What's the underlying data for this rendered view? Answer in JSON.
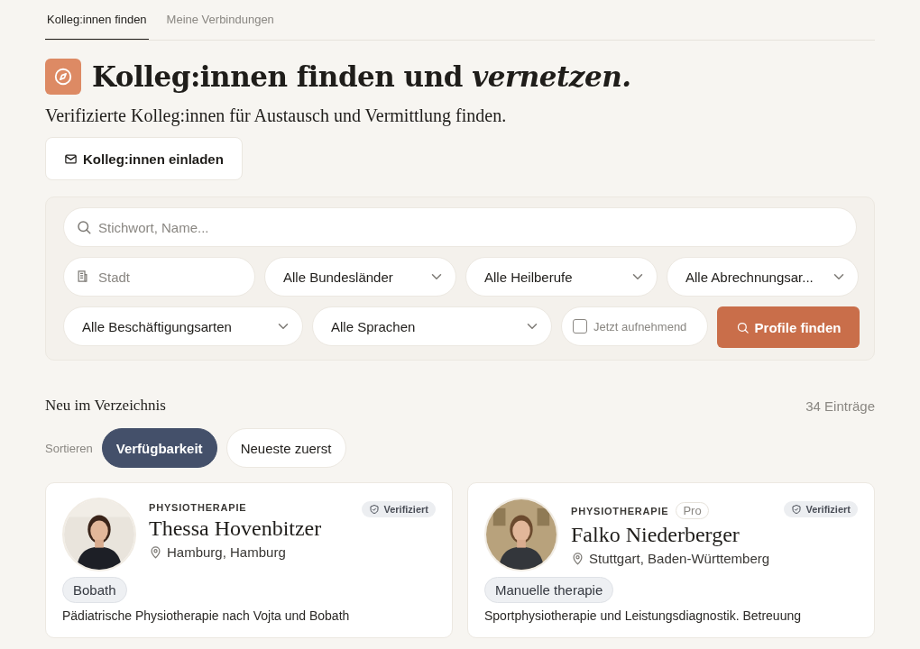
{
  "tabs": [
    {
      "label": "Kolleg:innen finden",
      "selected": true
    },
    {
      "label": "Meine Verbindungen",
      "selected": false
    }
  ],
  "header": {
    "title": "Kolleg:innen finden und *vernetzen.*",
    "subtitle": "Verifizierte Kolleg:innen für Austausch und Vermittlung finden.",
    "invite_button": "Kolleg:innen einladen"
  },
  "filters": {
    "search": {
      "placeholder": "Stichwort, Name..."
    },
    "city": {
      "placeholder": "Stadt"
    },
    "selects_row_1": [
      {
        "value": "Alle Bundesländer"
      },
      {
        "value": "Alle Heilberufe"
      },
      {
        "value": "Alle Abrechnungsar..."
      }
    ],
    "selects_row_2": [
      {
        "value": "Alle Beschäftigungsarten"
      },
      {
        "value": "Alle Sprachen"
      }
    ],
    "checkbox": {
      "label": "Jetzt aufnehmend",
      "checked": false
    },
    "submit_button": "Profile finden"
  },
  "listing": {
    "title": "Neu im Verzeichnis",
    "count": "34 Einträge",
    "sort_label": "Sortieren",
    "sort_options": [
      {
        "label": "Verfügbarkeit",
        "selected": true
      },
      {
        "label": "Neueste zuerst",
        "selected": false
      }
    ]
  },
  "cards": [
    {
      "category": "PHYSIOTHERAPIE",
      "name": "Thessa Hovenbitzer",
      "location": "Hamburg, Hamburg",
      "verified": "Verifiziert",
      "tags": [
        "Bobath"
      ],
      "description": "Pädiatrische Physiotherapie nach Vojta und Bobath",
      "photo": {
        "kind": "picture"
      }
    },
    {
      "category": "PHYSIOTHERAPIE",
      "badge": "Pro",
      "name": "Falko Niederberger",
      "location": "Stuttgart, Baden-Württemberg",
      "verified": "Verifiziert",
      "tags": [
        "Manuelle therapie"
      ],
      "description": "Sportphysiotherapie und Leistungsdiagnostik. Betreuung",
      "photo": {
        "kind": "picture"
      }
    }
  ]
}
